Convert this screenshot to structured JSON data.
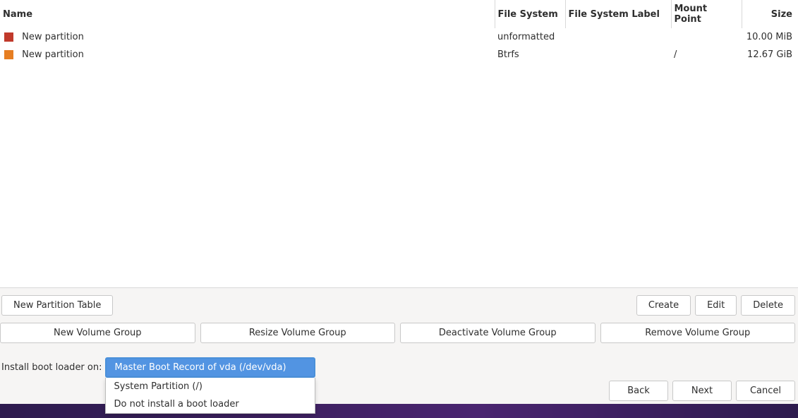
{
  "table": {
    "columns": {
      "name": "Name",
      "fs": "File System",
      "fslabel": "File System Label",
      "mountpoint": "Mount Point",
      "size": "Size"
    },
    "rows": [
      {
        "color": "#c0392b",
        "name": "New partition",
        "fs": "unformatted",
        "fslabel": "",
        "mountpoint": "",
        "size": "10.00 MiB"
      },
      {
        "color": "#e67e22",
        "name": "New partition",
        "fs": "Btrfs",
        "fslabel": "",
        "mountpoint": "/",
        "size": "12.67 GiB"
      }
    ]
  },
  "buttons": {
    "new_partition_table": "New Partition Table",
    "create": "Create",
    "edit": "Edit",
    "delete": "Delete",
    "new_vg": "New Volume Group",
    "resize_vg": "Resize Volume Group",
    "deactivate_vg": "Deactivate Volume Group",
    "remove_vg": "Remove Volume Group",
    "back": "Back",
    "next": "Next",
    "cancel": "Cancel"
  },
  "bootloader": {
    "label": "Install boot loader on:",
    "options": [
      "Master Boot Record of vda (/dev/vda)",
      "System Partition (/)",
      "Do not install a boot loader"
    ],
    "selected_index": 0
  }
}
